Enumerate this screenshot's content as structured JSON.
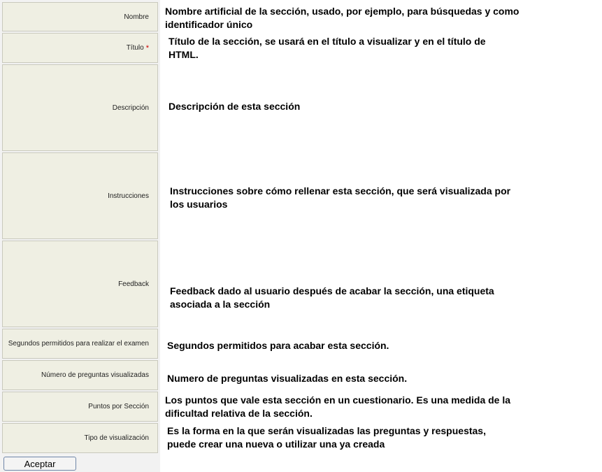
{
  "fields": [
    {
      "label": "Nombre",
      "required": false,
      "description": "Nombre artificial de la sección, usado, por ejemplo, para búsquedas y como identificador  único"
    },
    {
      "label": "Título",
      "required": true,
      "required_mark": "*",
      "description": "Título de la sección, se usará en el título a visualizar y en el título de HTML."
    },
    {
      "label": "Descripción",
      "required": false,
      "description": "Descripción de esta sección"
    },
    {
      "label": "Instrucciones",
      "required": false,
      "description": "Instrucciones sobre cómo rellenar esta sección, que  será  visualizada por los usuarios"
    },
    {
      "label": "Feedback",
      "required": false,
      "description": " Feedback dado al usuario después de acabar la sección, una etiqueta asociada a la sección"
    },
    {
      "label": "Segundos permitidos para realizar el examen",
      "required": false,
      "description": "Segundos permitidos para acabar esta sección."
    },
    {
      "label": "Número de preguntas visualizadas",
      "required": false,
      "description": "Numero de preguntas visualizadas en esta sección."
    },
    {
      "label": "Puntos por Sección",
      "required": false,
      "description": "Los puntos que vale esta sección en un cuestionario. Es una medida de la dificultad relativa de la sección."
    },
    {
      "label": "Tipo de visualización",
      "required": false,
      "description": "Es la forma en la que serán visualizadas las preguntas y respuestas, puede crear una nueva  o utilizar una ya creada"
    }
  ],
  "accept_button": {
    "label": "Aceptar"
  },
  "colors": {
    "label_bg": "#efefe3",
    "required_mark": "#cc0000"
  }
}
